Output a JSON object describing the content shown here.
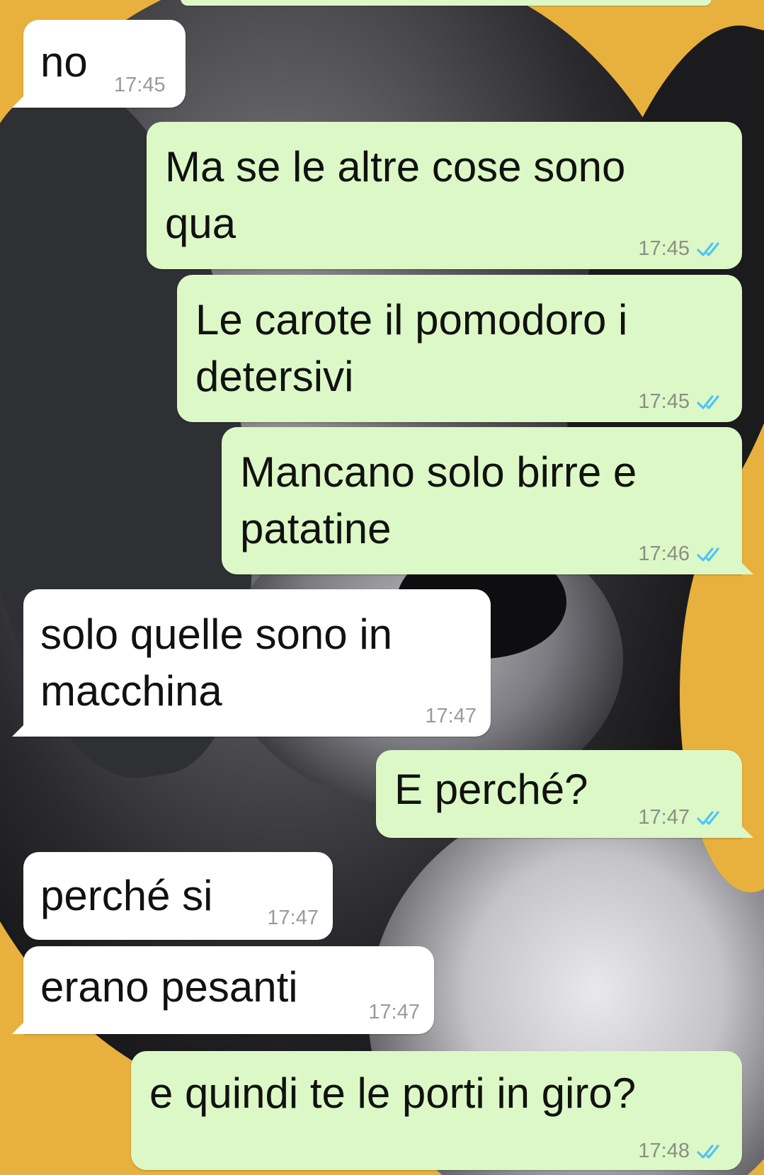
{
  "conversation": {
    "messages": [
      {
        "id": "m1",
        "direction": "incoming",
        "text": "no",
        "time": "17:45"
      },
      {
        "id": "m2",
        "direction": "outgoing",
        "text": "Ma se le altre cose sono\nqua",
        "time": "17:45",
        "status": "read"
      },
      {
        "id": "m3",
        "direction": "outgoing",
        "text": "Le carote il pomodoro i\ndetersivi",
        "time": "17:45",
        "status": "read"
      },
      {
        "id": "m4",
        "direction": "outgoing",
        "text": "Mancano solo birre e\npatatine",
        "time": "17:46",
        "status": "read"
      },
      {
        "id": "m5",
        "direction": "incoming",
        "text": "solo quelle sono in\nmacchina",
        "time": "17:47"
      },
      {
        "id": "m6",
        "direction": "outgoing",
        "text": "E perché?",
        "time": "17:47",
        "status": "read"
      },
      {
        "id": "m7",
        "direction": "incoming",
        "text": "perché si",
        "time": "17:47"
      },
      {
        "id": "m8",
        "direction": "incoming",
        "text": "erano pesanti",
        "time": "17:47"
      },
      {
        "id": "m9",
        "direction": "outgoing",
        "text": "e quindi te le porti in giro?",
        "time": "17:48",
        "status": "read"
      }
    ]
  },
  "icons": {
    "read_receipt": "double-check-icon"
  },
  "colors": {
    "incoming_bubble": "#ffffff",
    "outgoing_bubble": "#dcf8c6",
    "read_tick": "#4fc3f7",
    "timestamp": "#8a8f86",
    "wallpaper_base": "#e8b13d"
  }
}
